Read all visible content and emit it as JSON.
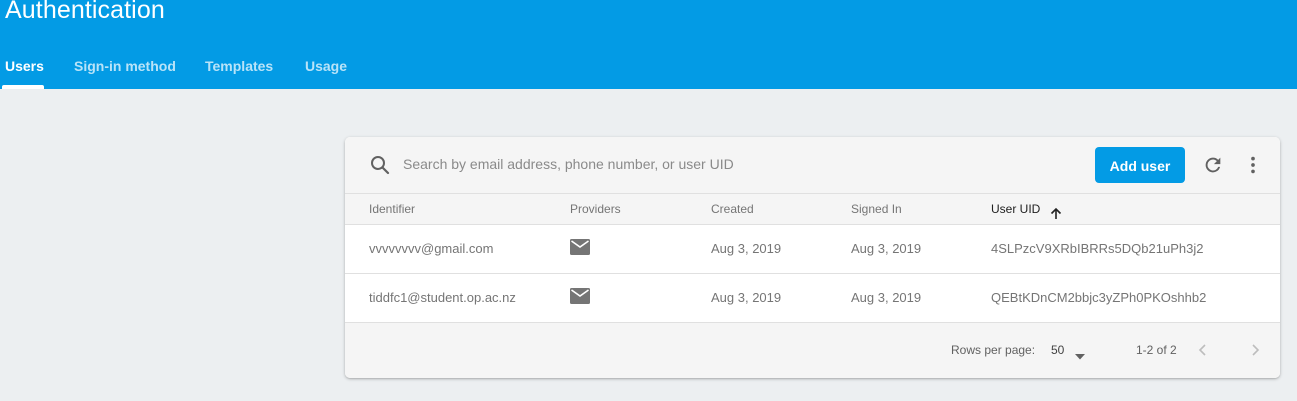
{
  "header": {
    "title": "Authentication",
    "tabs": [
      {
        "label": "Users"
      },
      {
        "label": "Sign-in method"
      },
      {
        "label": "Templates"
      },
      {
        "label": "Usage"
      }
    ],
    "color": "#039be5"
  },
  "toolbar": {
    "search_placeholder": "Search by email address, phone number, or user UID",
    "search_icon": "search-icon",
    "add_user_label": "Add user",
    "refresh_icon": "refresh-icon",
    "more_icon": "more-vert-icon"
  },
  "table": {
    "columns": [
      "Identifier",
      "Providers",
      "Created",
      "Signed In",
      "User UID"
    ],
    "sorted_column": "User UID",
    "sort_direction": "ascending",
    "rows": [
      {
        "identifier": "vvvvvvvv@gmail.com",
        "provider_icon": "email-icon",
        "created": "Aug 3, 2019",
        "signed_in": "Aug 3, 2019",
        "uid": "4SLPzcV9XRbIBRRs5DQb21uPh3j2"
      },
      {
        "identifier": "tiddfc1@student.op.ac.nz",
        "provider_icon": "email-icon",
        "created": "Aug 3, 2019",
        "signed_in": "Aug 3, 2019",
        "uid": "QEBtKDnCM2bbjc3yZPh0PKOshhb2"
      }
    ]
  },
  "pagination": {
    "rows_per_page_label": "Rows per page:",
    "rows_per_page": "50",
    "range": "1-2 of 2"
  }
}
